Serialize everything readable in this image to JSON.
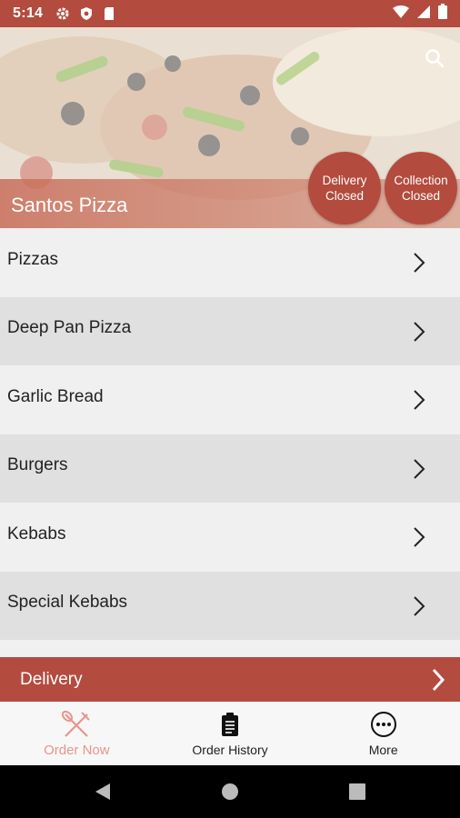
{
  "status_bar": {
    "time": "5:14",
    "icons": [
      "gear-icon",
      "shield-icon",
      "sd-card-icon",
      "wifi-icon",
      "signal-icon",
      "battery-icon"
    ]
  },
  "hero": {
    "restaurant_name": "Santos Pizza",
    "delivery_badge": {
      "line1": "Delivery",
      "line2": "Closed"
    },
    "collection_badge": {
      "line1": "Collection",
      "line2": "Closed"
    }
  },
  "menu": {
    "items": [
      {
        "label": "Pizzas"
      },
      {
        "label": "Deep Pan Pizza"
      },
      {
        "label": "Garlic Bread"
      },
      {
        "label": "Burgers"
      },
      {
        "label": "Kebabs"
      },
      {
        "label": "Special Kebabs"
      }
    ]
  },
  "delivery_bar": {
    "label": "Delivery"
  },
  "bottom_nav": {
    "items": [
      {
        "label": "Order Now",
        "icon": "fork-knife-icon",
        "active": true
      },
      {
        "label": "Order History",
        "icon": "clipboard-icon",
        "active": false
      },
      {
        "label": "More",
        "icon": "more-icon",
        "active": false
      }
    ]
  },
  "colors": {
    "accent": "#b44b3f",
    "active_tab": "#e8968a",
    "row_light": "#f0f0f0",
    "row_dark": "#e0e0e0"
  }
}
